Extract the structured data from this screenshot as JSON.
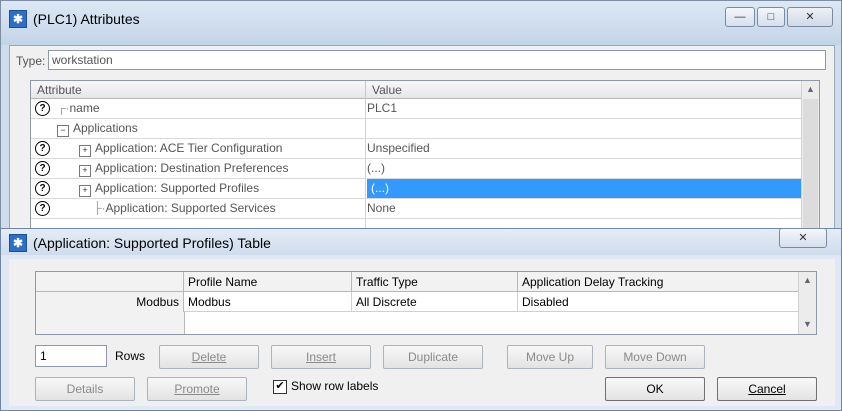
{
  "window": {
    "title": "(PLC1) Attributes",
    "controls": {
      "minimize": "—",
      "maximize": "□",
      "close": "✕"
    }
  },
  "type": {
    "label": "Type:",
    "value": "workstation"
  },
  "attributes_table": {
    "headers": {
      "attribute": "Attribute",
      "value": "Value"
    },
    "rows": [
      {
        "help": "?",
        "attribute": "name",
        "value": "PLC1"
      },
      {
        "help": "",
        "attribute": "Applications",
        "value": ""
      },
      {
        "help": "?",
        "attribute": "Application: ACE Tier Configuration",
        "value": "Unspecified"
      },
      {
        "help": "?",
        "attribute": "Application: Destination Preferences",
        "value": "(...)"
      },
      {
        "help": "?",
        "attribute": "Application: Supported Profiles",
        "value": "(...)"
      },
      {
        "help": "?",
        "attribute": "Application: Supported Services",
        "value": "None"
      }
    ]
  },
  "dialog": {
    "title": "(Application: Supported Profiles) Table",
    "close": "✕",
    "table": {
      "headers": [
        "Profile Name",
        "Traffic Type",
        "Application Delay Tracking"
      ],
      "rows": [
        {
          "label": "Modbus",
          "cells": [
            "Modbus",
            "All Discrete",
            "Disabled"
          ]
        }
      ]
    },
    "rows_value": "1",
    "rows_label": "Rows",
    "buttons": {
      "delete": "Delete",
      "insert": "Insert",
      "duplicate": "Duplicate",
      "move_up": "Move Up",
      "move_down": "Move Down",
      "details": "Details",
      "promote": "Promote",
      "ok": "OK",
      "cancel": "Cancel"
    },
    "show_row_labels": {
      "label": "Show row labels",
      "checked": true,
      "mark": "✔"
    }
  },
  "colors": {
    "selection": "#3399ff",
    "title_bar": "#cfdcec",
    "app_icon": "#2d6fc4"
  },
  "icons": {
    "app": "app-icon",
    "help": "help-icon",
    "tree_collapse": "minus-box-icon",
    "tree_expand": "plus-box-icon",
    "scroll_up": "scroll-up-arrow-icon",
    "scroll_down": "scroll-down-arrow-icon"
  }
}
